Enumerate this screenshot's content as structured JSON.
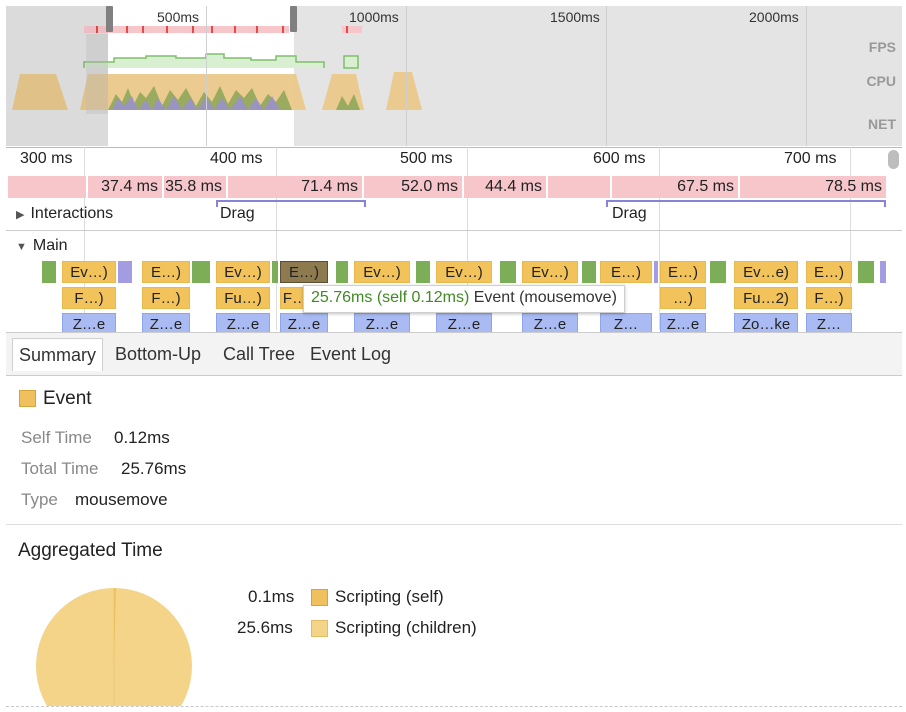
{
  "overview": {
    "ticks": [
      "500ms",
      "1000ms",
      "1500ms",
      "2000ms"
    ],
    "labels": {
      "fps": "FPS",
      "cpu": "CPU",
      "net": "NET"
    }
  },
  "ruler": {
    "ticks": [
      "300 ms",
      "400 ms",
      "500 ms",
      "600 ms",
      "700 ms"
    ]
  },
  "frames": [
    "37.4 ms",
    "35.8 ms",
    "71.4 ms",
    "52.0 ms",
    "44.4 ms",
    "",
    "67.5 ms",
    "78.5 ms"
  ],
  "interactions": {
    "label": "Interactions",
    "drags": [
      "Drag",
      "Drag"
    ]
  },
  "main": {
    "label": "Main",
    "row1": [
      "Ev…)",
      "E…)",
      "Ev…)",
      "E…)",
      "Ev…)",
      "Ev…)",
      "Ev…)",
      "E…)",
      "E…)",
      "Ev…e)",
      "E…)"
    ],
    "row2": [
      "F…)",
      "F…)",
      "Fu…)",
      "F…",
      "",
      "",
      "",
      "",
      "…)",
      "Fu…2)",
      "F…)"
    ],
    "row3": [
      "Z…e",
      "Z…e",
      "Z…e",
      "Z…e",
      "Z…e",
      "Z…e",
      "Z…e",
      "Z…",
      "Z…e",
      "Zo…ke",
      "Z…"
    ]
  },
  "tooltip": {
    "time": "25.76ms (self 0.12ms)",
    "name": "Event (mousemove)"
  },
  "tabs": [
    "Summary",
    "Bottom-Up",
    "Call Tree",
    "Event Log"
  ],
  "summary": {
    "title": "Event",
    "self_time_label": "Self Time",
    "self_time": "0.12ms",
    "total_time_label": "Total Time",
    "total_time": "25.76ms",
    "type_label": "Type",
    "type": "mousemove"
  },
  "aggregated": {
    "title": "Aggregated Time",
    "rows": [
      {
        "value": "0.1ms",
        "label": "Scripting (self)",
        "color": "#f0c05e"
      },
      {
        "value": "25.6ms",
        "label": "Scripting (children)",
        "color": "#f4d488"
      }
    ]
  },
  "colors": {
    "scripting": "#f2c25b",
    "frame": "#f6c6cb",
    "accent_green": "#3f8a22"
  }
}
